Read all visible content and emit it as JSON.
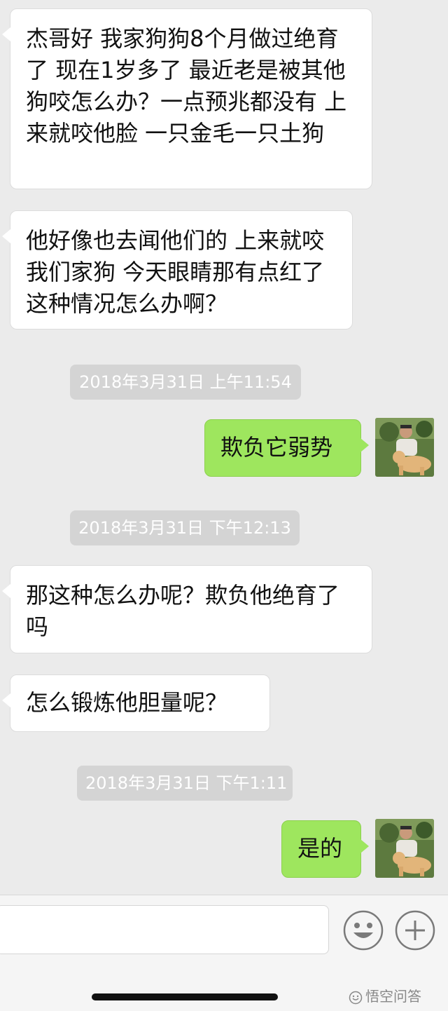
{
  "messages": [
    {
      "text": "杰哥好 我家狗狗8个月做过绝育了 现在1岁多了 最近老是被其他狗咬怎么办？一点预兆都没有 上来就咬他脸 一只金毛一只土狗"
    },
    {
      "text": "他好像也去闻他们的 上来就咬我们家狗 今天眼睛那有点红了 这种情况怎么办啊？"
    },
    {
      "time": "2018年3月31日 上午11:54"
    },
    {
      "text": "欺负它弱势"
    },
    {
      "time": "2018年3月31日 下午12:13"
    },
    {
      "text": "那这种怎么办呢？欺负他绝育了吗"
    },
    {
      "text": "怎么锻炼他胆量呢？"
    },
    {
      "time": "2018年3月31日 下午1:11"
    },
    {
      "text": "是的"
    }
  ],
  "input": {
    "placeholder": "",
    "emoji_icon": "emoji-icon",
    "plus_icon": "plus-icon"
  },
  "watermark": "悟空问答",
  "colors": {
    "background": "#ebebeb",
    "incoming_bubble": "#ffffff",
    "outgoing_bubble": "#9ee65e",
    "timestamp_pill": "#d4d4d4"
  }
}
